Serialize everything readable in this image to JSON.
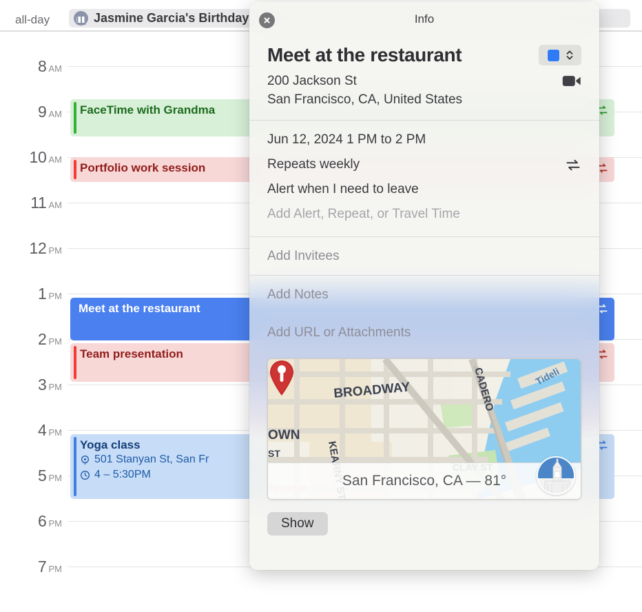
{
  "calendar": {
    "allday": {
      "label": "all-day",
      "event_title": "Jasmine Garcia's Birthday",
      "icon": "gift-icon"
    },
    "hours": [
      {
        "num": "8",
        "ampm": "AM"
      },
      {
        "num": "9",
        "ampm": "AM"
      },
      {
        "num": "10",
        "ampm": "AM"
      },
      {
        "num": "11",
        "ampm": "AM"
      },
      {
        "num": "12",
        "ampm": "PM"
      },
      {
        "num": "1",
        "ampm": "PM"
      },
      {
        "num": "2",
        "ampm": "PM"
      },
      {
        "num": "3",
        "ampm": "PM"
      },
      {
        "num": "4",
        "ampm": "PM"
      },
      {
        "num": "5",
        "ampm": "PM"
      },
      {
        "num": "6",
        "ampm": "PM"
      },
      {
        "num": "7",
        "ampm": "PM"
      }
    ],
    "events": [
      {
        "title": "FaceTime with Grandma",
        "color": "#34b233",
        "background": "#d8f0d8",
        "recurring_icon": "repeat-icon"
      },
      {
        "title": "Portfolio work session",
        "color": "#f03b36",
        "background": "#f8d7d7",
        "recurring_icon": "repeat-icon"
      },
      {
        "title": "Meet at the restaurant",
        "color": "#4a80ef",
        "background": "#4a80ef",
        "recurring_icon": "repeat-icon"
      },
      {
        "title": "Team presentation",
        "color": "#f03b36",
        "background": "#f8d7d7",
        "recurring_icon": "repeat-icon"
      },
      {
        "title": "Yoga class",
        "location": "501 Stanyan St, San Fr",
        "time": "4 – 5:30PM",
        "color": "#3f7fe0",
        "background": "#c7dcf7",
        "recurring_icon": "repeat-icon"
      }
    ]
  },
  "popover": {
    "window_title": "Info",
    "close_icon": "close-icon",
    "event_title": "Meet at the restaurant",
    "calendar_color": "#2f7bf6",
    "color_picker_icon": "chevron-updown-icon",
    "address_line1": "200 Jackson St",
    "address_line2": "San Francisco, CA, United States",
    "video_icon": "video-camera-icon",
    "date_time": "Jun 12, 2024  1 PM to 2 PM",
    "repeat": "Repeats weekly",
    "repeat_icon": "repeat-icon",
    "alert": "Alert when I need to leave",
    "add_alert_placeholder": "Add Alert, Repeat, or Travel Time",
    "add_invitees_placeholder": "Add Invitees",
    "add_notes_placeholder": "Add Notes",
    "add_url_placeholder": "Add URL or Attachments",
    "map": {
      "caption": "San Francisco, CA — 81°",
      "pin_icon": "map-pin-icon",
      "badge_icon": "ferry-building-icon",
      "streets": [
        "BROADWAY",
        "KEARNY ST",
        "EMBARCADERO",
        "CLAY ST",
        "CHINATOWN",
        "Tideline"
      ]
    },
    "show_button": "Show"
  }
}
